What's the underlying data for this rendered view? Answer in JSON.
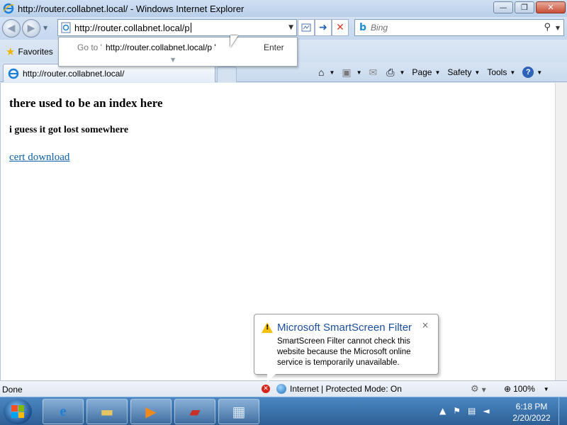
{
  "window": {
    "title": "http://router.collabnet.local/ - Windows Internet Explorer",
    "controls": {
      "minimize": "—",
      "maximize": "❐",
      "close": "✕"
    }
  },
  "navigation": {
    "address_value": "http://router.collabnet.local/p",
    "search_placeholder": "Bing",
    "back_glyph": "◀",
    "forward_glyph": "▶"
  },
  "autocomplete": {
    "goto_label": "Go to '",
    "url": "http://router.collabnet.local/p '",
    "enter_label": "Enter"
  },
  "favorites": {
    "label": "Favorites"
  },
  "tab": {
    "label": "http://router.collabnet.local/"
  },
  "commandbar": {
    "page": "Page",
    "safety": "Safety",
    "tools": "Tools",
    "help": "?"
  },
  "page": {
    "heading": "there used to be an index here",
    "subheading": "i guess it got lost somewhere",
    "link": "cert download"
  },
  "smartscreen": {
    "title": "Microsoft SmartScreen Filter",
    "message": "SmartScreen Filter cannot check this website because the Microsoft online service is temporarily unavailable.",
    "close": "×"
  },
  "statusbar": {
    "status": "Done",
    "zone": "Internet | Protected Mode: On",
    "zoom": "100%"
  },
  "taskbar": {
    "time": "6:18 PM",
    "date": "2/20/2022"
  },
  "colors": {
    "accent": "#1c4fa0",
    "link": "#0b5fa8",
    "taskbar": "#2d5f95"
  }
}
